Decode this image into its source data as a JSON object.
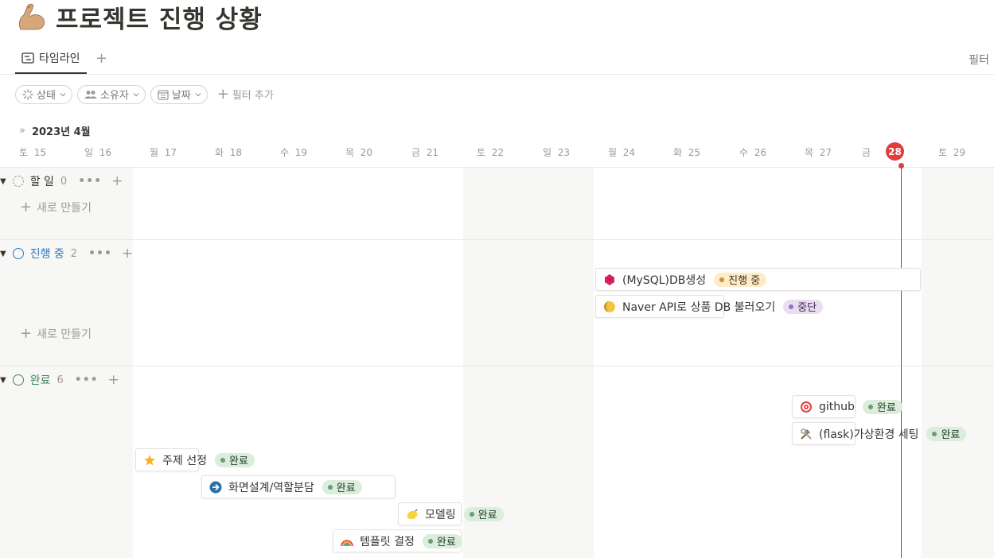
{
  "page": {
    "title": "프로젝트 진행 상황",
    "icon": "flexed-biceps-icon"
  },
  "tabs": {
    "active_label": "타임라인",
    "filter_label": "필터"
  },
  "filters": {
    "status": "상태",
    "owner": "소유자",
    "date": "날짜",
    "add": "필터 추가"
  },
  "timeline": {
    "month_label": "2023년 4월",
    "days": [
      {
        "dow": "토",
        "num": "15"
      },
      {
        "dow": "일",
        "num": "16"
      },
      {
        "dow": "월",
        "num": "17"
      },
      {
        "dow": "화",
        "num": "18"
      },
      {
        "dow": "수",
        "num": "19"
      },
      {
        "dow": "목",
        "num": "20"
      },
      {
        "dow": "금",
        "num": "21"
      },
      {
        "dow": "토",
        "num": "22"
      },
      {
        "dow": "일",
        "num": "23"
      },
      {
        "dow": "월",
        "num": "24"
      },
      {
        "dow": "화",
        "num": "25"
      },
      {
        "dow": "수",
        "num": "26"
      },
      {
        "dow": "목",
        "num": "27"
      },
      {
        "dow": "금",
        "num": "28"
      },
      {
        "dow": "토",
        "num": "29"
      }
    ],
    "today": "28"
  },
  "groups": {
    "todo": {
      "label": "할 일",
      "count": "0",
      "new_label": "새로 만들기"
    },
    "in_progress": {
      "label": "진행 중",
      "count": "2",
      "new_label": "새로 만들기"
    },
    "done": {
      "label": "완료",
      "count": "6"
    }
  },
  "items": {
    "mysql": {
      "title": "(MySQL)DB생성",
      "status": "진행 중",
      "icon": "gem-icon"
    },
    "naver": {
      "title": "Naver API로 상품 DB 불러오기",
      "status": "중단",
      "icon": "moon-icon"
    },
    "github": {
      "title": "github",
      "status": "완료",
      "icon": "target-icon"
    },
    "flask": {
      "title": "(flask)가상환경 세팅",
      "status": "완료",
      "icon": "tools-icon"
    },
    "topic": {
      "title": "주제 선정",
      "status": "완료",
      "icon": "star-icon"
    },
    "screen": {
      "title": "화면설계/역할분담",
      "status": "완료",
      "icon": "arrow-right-circle-icon"
    },
    "model": {
      "title": "모델링",
      "status": "완료",
      "icon": "lemon-icon"
    },
    "template": {
      "title": "템플릿 결정",
      "status": "완료",
      "icon": "rainbow-icon"
    }
  },
  "colors": {
    "today": "#e03e3e",
    "done_badge": "#dbeddb",
    "progress_badge": "#fdecc8",
    "stopped_badge": "#e8deee",
    "group_in_progress": "#2e7ab5",
    "group_done": "#448361"
  }
}
